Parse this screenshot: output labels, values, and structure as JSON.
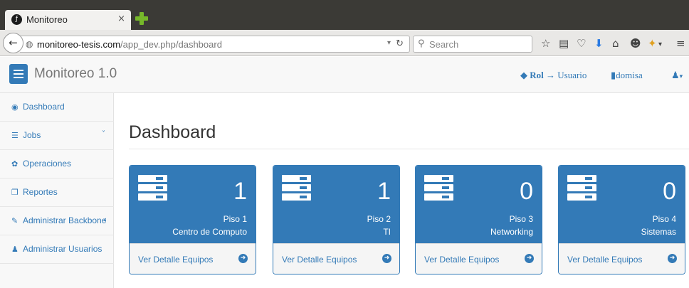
{
  "browser": {
    "tab_title": "Monitoreo",
    "tab_close": "×",
    "url_host": "monitoreo-tesis.com",
    "url_path": "/app_dev.php/dashboard",
    "search_placeholder": "Search",
    "toolbar_icons": [
      "star-icon",
      "reading-list-icon",
      "pocket-icon",
      "download-icon",
      "home-icon",
      "chat-icon",
      "extension-icon",
      "menu-icon"
    ]
  },
  "header": {
    "menu_toggle": "menu-toggle",
    "brand": "Monitoreo 1.0",
    "role_label": "Rol",
    "role_arrow": "→",
    "role_value": "Usuario",
    "username": "domisa"
  },
  "sidebar": {
    "items": [
      {
        "icon": "dashboard-icon",
        "label": "Dashboard"
      },
      {
        "icon": "list-icon",
        "label": "Jobs",
        "chevron": "˅"
      },
      {
        "icon": "gear-icon",
        "label": "Operaciones"
      },
      {
        "icon": "copy-icon",
        "label": "Reportes"
      },
      {
        "icon": "wrench-icon",
        "label": "Administrar Backbone",
        "chevron": "‹"
      },
      {
        "icon": "user-icon",
        "label": "Administrar Usuarios"
      }
    ]
  },
  "main": {
    "title": "Dashboard",
    "panels": [
      {
        "count": "1",
        "floor": "Piso 1",
        "area": "Centro de Computo",
        "link": "Ver Detalle Equipos"
      },
      {
        "count": "1",
        "floor": "Piso 2",
        "area": "TI",
        "link": "Ver Detalle Equipos"
      },
      {
        "count": "0",
        "floor": "Piso 3",
        "area": "Networking",
        "link": "Ver Detalle Equipos"
      },
      {
        "count": "0",
        "floor": "Piso 4",
        "area": "Sistemas",
        "link": "Ver Detalle Equipos"
      }
    ]
  },
  "colors": {
    "primary": "#337ab7",
    "panel_footer": "#f5f5f5",
    "sidebar_bg": "#f8f8f8",
    "chrome_dark": "#3b3a36"
  }
}
